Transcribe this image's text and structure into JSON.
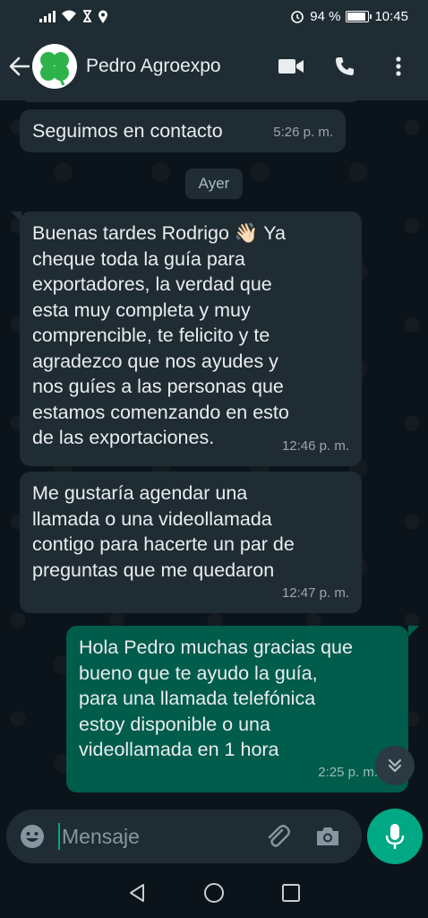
{
  "status_bar": {
    "battery": "94 %",
    "time": "10:45"
  },
  "header": {
    "contact_name": "Pedro Agroexpo",
    "icons": [
      "back-arrow-icon",
      "clover-avatar",
      "video-call-icon",
      "phone-icon",
      "more-vert-icon"
    ]
  },
  "chat": {
    "date_separator": "Ayer",
    "messages": [
      {
        "direction": "in",
        "text": "Seguimos en contacto",
        "time": "5:26 p. m."
      },
      {
        "direction": "in",
        "text": "Buenas tardes Rodrigo 👋🏻 Ya\ncheque toda la guía para\nexportadores, la verdad que\nesta muy completa y muy\ncomprencible, te felicito y te\nagradezco que nos ayudes y\nnos guíes a las personas que\nestamos comenzando en esto\nde las exportaciones.",
        "time": "12:46 p. m."
      },
      {
        "direction": "in",
        "text": "Me gustaría agendar una\nllamada o una videollamada\ncontigo para hacerte un par de\npreguntas que me quedaron",
        "time": "12:47 p. m."
      },
      {
        "direction": "out",
        "text": "Hola Pedro muchas gracias que\nbueno que te ayudo la guía,\npara una llamada telefónica\nestoy disponible o una\nvideollamada en 1 hora",
        "time": "2:25 p. m."
      }
    ]
  },
  "composer": {
    "placeholder": "Mensaje"
  },
  "colors": {
    "header_bg": "#1f2c34",
    "chat_bg": "#0b141a",
    "incoming_bubble": "#202c33",
    "outgoing_bubble": "#005c4b",
    "accent": "#00a884"
  }
}
